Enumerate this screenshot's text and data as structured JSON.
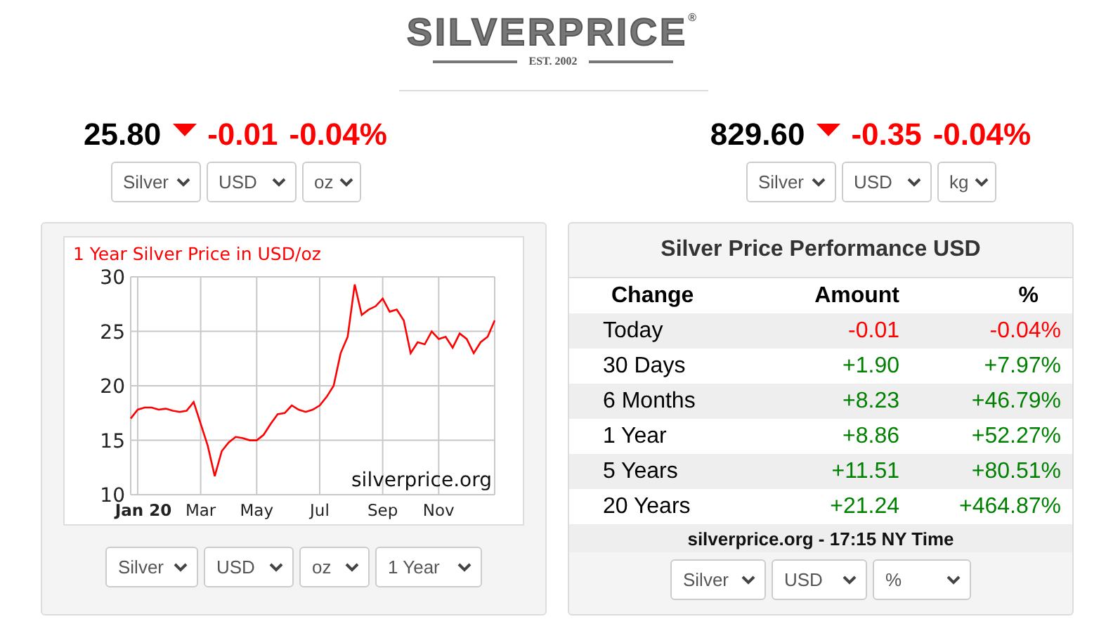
{
  "logo": {
    "name": "SILVERPRICE",
    "mark": "®",
    "established": "EST. 2002"
  },
  "quotes": [
    {
      "price": "25.80",
      "kind": "down",
      "color": "#ff0000",
      "change": "-0.01",
      "percent": "-0.04%",
      "selectors": [
        "Silver",
        "USD",
        "oz"
      ]
    },
    {
      "price": "829.60",
      "kind": "down",
      "color": "#ff0000",
      "change": "-0.35",
      "percent": "-0.04%",
      "selectors": [
        "Silver",
        "USD",
        "kg"
      ]
    }
  ],
  "chart_panel": {
    "chart_data": {
      "type": "line",
      "title": "1 Year Silver Price in USD/oz",
      "categories": [
        null,
        "Jan 20",
        null,
        null,
        null,
        null,
        null,
        null,
        null,
        null,
        "Mar",
        null,
        null,
        null,
        null,
        null,
        null,
        null,
        "May",
        null,
        null,
        null,
        null,
        null,
        null,
        null,
        null,
        "Jul",
        null,
        null,
        null,
        null,
        null,
        null,
        null,
        null,
        "Sep",
        null,
        null,
        null,
        null,
        null,
        null,
        null,
        "Nov",
        null,
        null,
        null,
        null,
        null,
        null,
        null,
        null
      ],
      "series": [
        {
          "color": "#ff0000",
          "values": [
            17.0,
            17.8,
            18.0,
            18.0,
            17.8,
            17.9,
            17.7,
            17.6,
            17.7,
            18.5,
            16.5,
            14.5,
            11.7,
            14.0,
            14.8,
            15.3,
            15.2,
            15.0,
            15.0,
            15.5,
            16.5,
            17.4,
            17.5,
            18.2,
            17.8,
            17.6,
            17.8,
            18.2,
            19.0,
            20.0,
            23.0,
            24.5,
            29.3,
            26.5,
            27.0,
            27.3,
            28.0,
            26.8,
            27.0,
            26.0,
            23.0,
            24.0,
            23.8,
            25.0,
            24.3,
            24.5,
            23.5,
            24.8,
            24.3,
            23.0,
            24.0,
            24.5,
            26.0
          ]
        }
      ],
      "grid": true,
      "ylim": [
        10,
        30
      ],
      "yticks": [
        10,
        15,
        20,
        25,
        30
      ],
      "annotations": [
        "silverprice.org"
      ]
    },
    "selectors": [
      "Silver",
      "USD",
      "oz",
      "1 Year"
    ]
  },
  "performance": {
    "title": "Silver Price Performance USD",
    "columns": [
      "Change",
      "Amount",
      "%"
    ],
    "rows": [
      {
        "period": "Today",
        "amount": "-0.01",
        "percent": "-0.04%",
        "color": "#ff0000"
      },
      {
        "period": "30 Days",
        "amount": "+1.90",
        "percent": "+7.97%",
        "color": "#008000"
      },
      {
        "period": "6 Months",
        "amount": "+8.23",
        "percent": "+46.79%",
        "color": "#008000"
      },
      {
        "period": "1 Year",
        "amount": "+8.86",
        "percent": "+52.27%",
        "color": "#008000"
      },
      {
        "period": "5 Years",
        "amount": "+11.51",
        "percent": "+80.51%",
        "color": "#008000"
      },
      {
        "period": "20 Years",
        "amount": "+21.24",
        "percent": "+464.87%",
        "color": "#008000"
      }
    ],
    "footer": "silverprice.org - 17:15 NY Time",
    "selectors": [
      "Silver",
      "USD",
      "%"
    ]
  }
}
